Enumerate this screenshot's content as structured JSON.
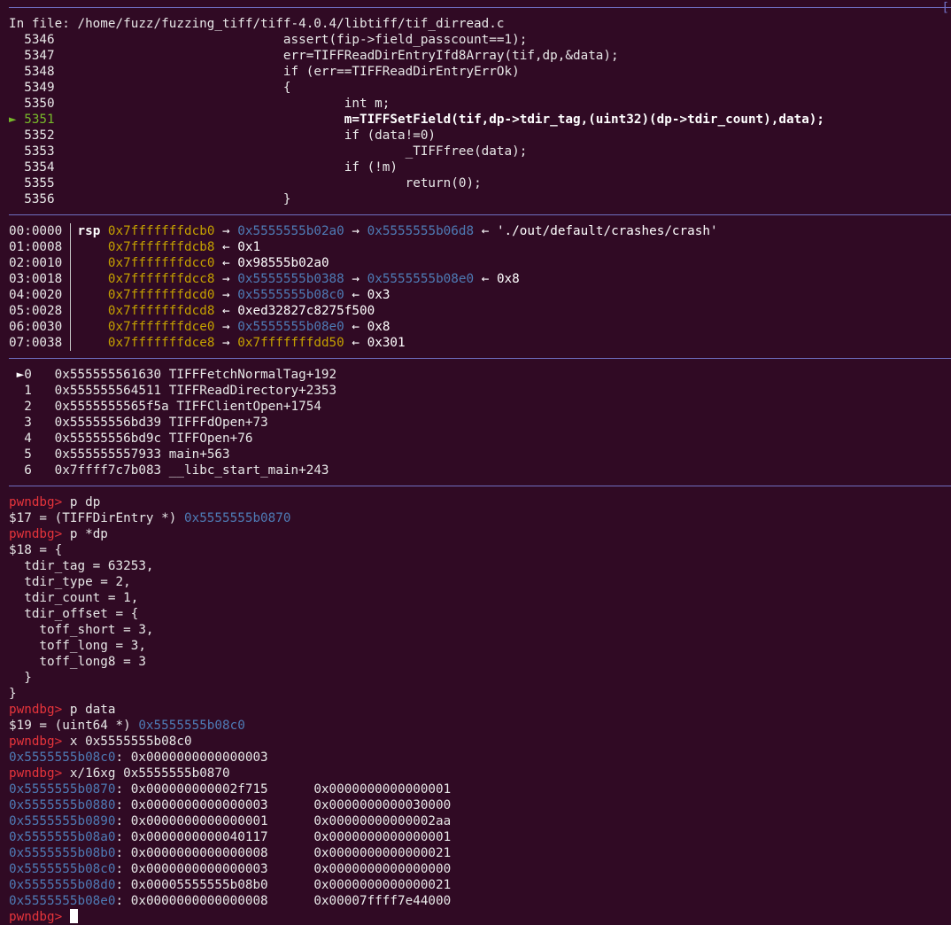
{
  "colors": {
    "background": "#300a24",
    "separator": "#6f6ec0",
    "address": "#c4a000",
    "heap": "#4e7bb5",
    "prompt": "#e6343b",
    "current_line": "#77b82a"
  },
  "source": {
    "header": "In file: /home/fuzz/fuzzing_tiff/tiff-4.0.4/libtiff/tif_dirread.c",
    "lines": [
      {
        "no": "5346",
        "indent": "                              ",
        "code": "assert(fip->field_passcount==1);"
      },
      {
        "no": "5347",
        "indent": "                              ",
        "code": "err=TIFFReadDirEntryIfd8Array(tif,dp,&data);"
      },
      {
        "no": "5348",
        "indent": "                              ",
        "code": "if (err==TIFFReadDirEntryErrOk)"
      },
      {
        "no": "5349",
        "indent": "                              ",
        "code": "{"
      },
      {
        "no": "5350",
        "indent": "                                      ",
        "code": "int m;"
      },
      {
        "no": "5351",
        "indent": "                                      ",
        "code": "m=TIFFSetField(tif,dp->tdir_tag,(uint32)(dp->tdir_count),data);",
        "current": true
      },
      {
        "no": "5352",
        "indent": "                                      ",
        "code": "if (data!=0)"
      },
      {
        "no": "5353",
        "indent": "                                              ",
        "code": "_TIFFfree(data);"
      },
      {
        "no": "5354",
        "indent": "                                      ",
        "code": "if (!m)"
      },
      {
        "no": "5355",
        "indent": "                                              ",
        "code": "return(0);"
      },
      {
        "no": "5356",
        "indent": "                              ",
        "code": "}"
      }
    ]
  },
  "stack": [
    {
      "off": "00:0000",
      "reg": "rsp",
      "addr": "0x7fffffffdcb0",
      "chain": [
        [
          "→",
          "0x5555555b02a0",
          "blue"
        ],
        [
          "→",
          "0x5555555b06d8",
          "blue"
        ],
        [
          "←",
          "'./out/default/crashes/crash'",
          "white"
        ]
      ]
    },
    {
      "off": "01:0008",
      "reg": "",
      "addr": "0x7fffffffdcb8",
      "chain": [
        [
          "←",
          "0x1",
          "white"
        ]
      ]
    },
    {
      "off": "02:0010",
      "reg": "",
      "addr": "0x7fffffffdcc0",
      "chain": [
        [
          "←",
          "0x98555b02a0",
          "white"
        ]
      ]
    },
    {
      "off": "03:0018",
      "reg": "",
      "addr": "0x7fffffffdcc8",
      "chain": [
        [
          "→",
          "0x5555555b0388",
          "blue"
        ],
        [
          "→",
          "0x5555555b08e0",
          "blue"
        ],
        [
          "←",
          "0x8",
          "white"
        ]
      ]
    },
    {
      "off": "04:0020",
      "reg": "",
      "addr": "0x7fffffffdcd0",
      "chain": [
        [
          "→",
          "0x5555555b08c0",
          "blue"
        ],
        [
          "←",
          "0x3",
          "white"
        ]
      ]
    },
    {
      "off": "05:0028",
      "reg": "",
      "addr": "0x7fffffffdcd8",
      "chain": [
        [
          "←",
          "0xed32827c8275f500",
          "white"
        ]
      ]
    },
    {
      "off": "06:0030",
      "reg": "",
      "addr": "0x7fffffffdce0",
      "chain": [
        [
          "→",
          "0x5555555b08e0",
          "blue"
        ],
        [
          "←",
          "0x8",
          "white"
        ]
      ]
    },
    {
      "off": "07:0038",
      "reg": "",
      "addr": "0x7fffffffdce8",
      "chain": [
        [
          "→",
          "0x7fffffffdd50",
          "yellow"
        ],
        [
          "←",
          "0x301",
          "white"
        ]
      ]
    }
  ],
  "backtrace": [
    {
      "marker": "►",
      "idx": "0",
      "addr": "0x555555561630",
      "sym": "TIFFFetchNormalTag+192"
    },
    {
      "marker": " ",
      "idx": "1",
      "addr": "0x555555564511",
      "sym": "TIFFReadDirectory+2353"
    },
    {
      "marker": " ",
      "idx": "2",
      "addr": "0x5555555565f5a",
      "sym": "TIFFClientOpen+1754"
    },
    {
      "marker": " ",
      "idx": "3",
      "addr": "0x55555556bd39",
      "sym": "TIFFFdOpen+73"
    },
    {
      "marker": " ",
      "idx": "4",
      "addr": "0x55555556bd9c",
      "sym": "TIFFOpen+76"
    },
    {
      "marker": " ",
      "idx": "5",
      "addr": "0x555555557933",
      "sym": "main+563"
    },
    {
      "marker": " ",
      "idx": "6",
      "addr": "0x7ffff7c7b083",
      "sym": "__libc_start_main+243"
    }
  ],
  "prompt": "pwndbg>",
  "session": {
    "cmd1": "p dp",
    "out1_text": "$17 = (TIFFDirEntry *) ",
    "out1_addr": "0x5555555b0870",
    "cmd2": "p *dp",
    "struct_lines": [
      "$18 = {",
      "  tdir_tag = 63253,",
      "  tdir_type = 2,",
      "  tdir_count = 1,",
      "  tdir_offset = {",
      "    toff_short = 3,",
      "    toff_long = 3,",
      "    toff_long8 = 3",
      "  }",
      "}"
    ],
    "cmd3": "p data",
    "out3_text": "$19 = (uint64 *) ",
    "out3_addr": "0x5555555b08c0",
    "cmd4": "x 0x5555555b08c0",
    "x_addr": "0x5555555b08c0",
    "x_val": ": 0x0000000000000003",
    "cmd5": "x/16xg 0x5555555b0870",
    "dump": [
      {
        "addr": "0x5555555b0870",
        "v1": "0x000000000002f715",
        "v2": "0x0000000000000001"
      },
      {
        "addr": "0x5555555b0880",
        "v1": "0x0000000000000003",
        "v2": "0x0000000000030000"
      },
      {
        "addr": "0x5555555b0890",
        "v1": "0x0000000000000001",
        "v2": "0x00000000000002aa"
      },
      {
        "addr": "0x5555555b08a0",
        "v1": "0x0000000000040117",
        "v2": "0x0000000000000001"
      },
      {
        "addr": "0x5555555b08b0",
        "v1": "0x0000000000000008",
        "v2": "0x0000000000000021"
      },
      {
        "addr": "0x5555555b08c0",
        "v1": "0x0000000000000003",
        "v2": "0x0000000000000000"
      },
      {
        "addr": "0x5555555b08d0",
        "v1": "0x00005555555b08b0",
        "v2": "0x0000000000000021"
      },
      {
        "addr": "0x5555555b08e0",
        "v1": "0x0000000000000008",
        "v2": "0x00007ffff7e44000"
      }
    ]
  }
}
